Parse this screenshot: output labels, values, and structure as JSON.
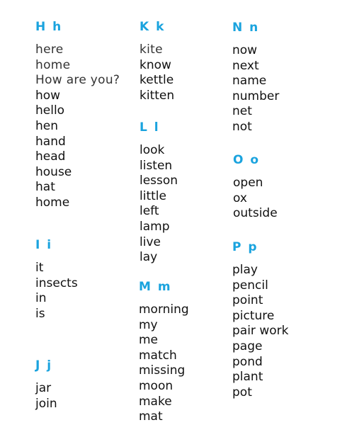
{
  "sections": [
    {
      "id": "h",
      "heading": "H h",
      "light_words": [
        "here",
        "home",
        "How are you?"
      ],
      "words": [
        "how",
        "hello",
        "hen",
        "hand",
        "head",
        "house",
        "hat",
        "home"
      ]
    },
    {
      "id": "i",
      "heading": "I i",
      "light_words": [],
      "words": [
        "it",
        "insects",
        "in",
        "is"
      ]
    },
    {
      "id": "j",
      "heading": "J j",
      "light_words": [],
      "words": [
        "jar",
        "join"
      ]
    },
    {
      "id": "k",
      "heading": "K k",
      "light_words": [
        "kite"
      ],
      "words": [
        "know",
        "kettle",
        "kitten"
      ]
    },
    {
      "id": "l",
      "heading": "L l",
      "light_words": [],
      "words": [
        "look",
        "listen",
        "lesson",
        "little",
        "left",
        "lamp",
        "live",
        "lay"
      ]
    },
    {
      "id": "m",
      "heading": "M m",
      "light_words": [],
      "words": [
        "morning",
        "my",
        "me",
        "match",
        "missing",
        "moon",
        "make",
        "mat"
      ]
    },
    {
      "id": "n",
      "heading": "N n",
      "light_words": [],
      "words": [
        "now",
        "next",
        "name",
        "number",
        "net",
        "not"
      ]
    },
    {
      "id": "o",
      "heading": "O o",
      "light_words": [],
      "words": [
        "open",
        "ox",
        "outside"
      ]
    },
    {
      "id": "p",
      "heading": "P p",
      "light_words": [],
      "words": [
        "play",
        "pencil",
        "point",
        "picture",
        "pair work",
        "page",
        "pond",
        "plant",
        "pot"
      ]
    }
  ],
  "colors": {
    "heading": "#1aa3de",
    "text": "#111111"
  }
}
